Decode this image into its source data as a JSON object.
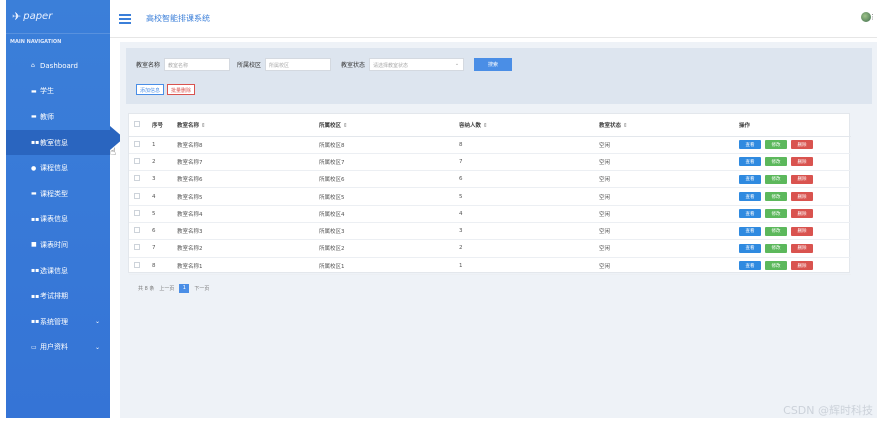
{
  "app": {
    "logo": "paper",
    "system_title": "高校智能排课系统"
  },
  "sidebar": {
    "header": "MAIN NAVIGATION",
    "items": [
      {
        "label": "Dashboard",
        "icon": "home-icon"
      },
      {
        "label": "学生",
        "icon": "list-icon"
      },
      {
        "label": "教师",
        "icon": "list-icon"
      },
      {
        "label": "教室信息",
        "icon": "grid-icon",
        "active": true
      },
      {
        "label": "课程信息",
        "icon": "location-icon"
      },
      {
        "label": "课程类型",
        "icon": "list-icon"
      },
      {
        "label": "课表信息",
        "icon": "grid-icon"
      },
      {
        "label": "课表时间",
        "icon": "lock-icon"
      },
      {
        "label": "选课信息",
        "icon": "grid-icon"
      },
      {
        "label": "考试排期",
        "icon": "grid-icon"
      },
      {
        "label": "系统管理",
        "icon": "grid-icon",
        "caret": "⌄"
      },
      {
        "label": "用户资料",
        "icon": "folder-icon",
        "caret": "⌄"
      }
    ]
  },
  "filters": {
    "room_name_label": "教室名称",
    "room_name_placeholder": "教室名称",
    "campus_label": "所属校区",
    "campus_placeholder": "所属校区",
    "status_label": "教室状态",
    "status_placeholder": "请选择教室状态",
    "search_button": "搜索",
    "add_button": "添加信息",
    "batch_delete_button": "批量删除"
  },
  "table": {
    "headers": [
      "序号",
      "教室名称",
      "所属校区",
      "容纳人数",
      "教室状态",
      "操作"
    ],
    "rows": [
      {
        "no": "1",
        "name": "教室名称8",
        "campus": "所属校区8",
        "capacity": "8",
        "status": "空闲"
      },
      {
        "no": "2",
        "name": "教室名称7",
        "campus": "所属校区7",
        "capacity": "7",
        "status": "空闲"
      },
      {
        "no": "3",
        "name": "教室名称6",
        "campus": "所属校区6",
        "capacity": "6",
        "status": "空闲"
      },
      {
        "no": "4",
        "name": "教室名称5",
        "campus": "所属校区5",
        "capacity": "5",
        "status": "空闲"
      },
      {
        "no": "5",
        "name": "教室名称4",
        "campus": "所属校区4",
        "capacity": "4",
        "status": "空闲"
      },
      {
        "no": "6",
        "name": "教室名称3",
        "campus": "所属校区3",
        "capacity": "3",
        "status": "空闲"
      },
      {
        "no": "7",
        "name": "教室名称2",
        "campus": "所属校区2",
        "capacity": "2",
        "status": "空闲"
      },
      {
        "no": "8",
        "name": "教室名称1",
        "campus": "所属校区1",
        "capacity": "1",
        "status": "空闲"
      }
    ],
    "actions": {
      "view": "查看",
      "edit": "修改",
      "delete": "删除"
    }
  },
  "pagination": {
    "total": "共 8 条",
    "prev": "上一页",
    "current": "1",
    "next": "下一页"
  },
  "watermark": "CSDN @辉时科技",
  "colors": {
    "sidebar": "#3b7fd9",
    "accent": "#4a8ee6",
    "view": "#2f8ae0",
    "edit": "#5cb85c",
    "delete": "#d9534f"
  }
}
